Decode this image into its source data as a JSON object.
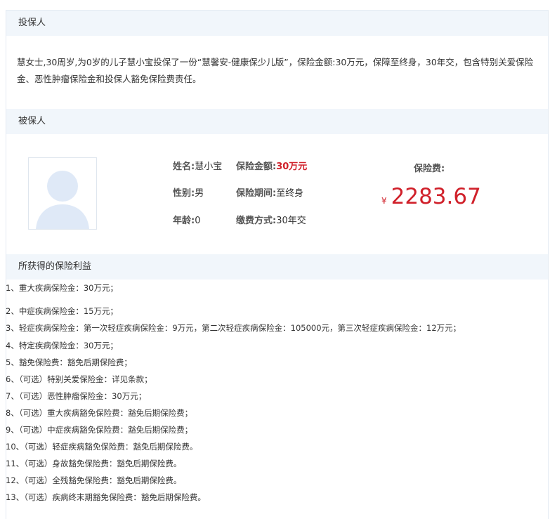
{
  "policyholder": {
    "header": "投保人",
    "summary": "慧女士,30周岁,为0岁的儿子慧小宝投保了一份“慧馨安-健康保少儿版”，保险金额:30万元，保障至终身，30年交，包含特别关爱保险金、恶性肿瘤保险金和投保人豁免保险费责任。"
  },
  "insured": {
    "header": "被保人",
    "name_label": "姓名:",
    "name_value": "慧小宝",
    "gender_label": "性别:",
    "gender_value": "男",
    "age_label": "年龄:",
    "age_value": "0",
    "sum_label": "保险金额:",
    "sum_value": "30万元",
    "period_label": "保险期间:",
    "period_value": "至终身",
    "payment_label": "缴费方式:",
    "payment_value": "30年交",
    "premium_label": "保险费:",
    "currency": "¥",
    "premium_value": "2283.67"
  },
  "benefits": {
    "header": "所获得的保险利益",
    "items": [
      "1、重大疾病保险金：30万元；",
      "2、中症疾病保险金：15万元；",
      "3、轻症疾病保险金：第一次轻症疾病保险金：9万元，第二次轻症疾病保险金：105000元，第三次轻症疾病保险金：12万元；",
      "4、特定疾病保险金：30万元；",
      "5、豁免保险费：豁免后期保险费；",
      "6、（可选）特别关爱保险金：详见条款；",
      "7、（可选）恶性肿瘤保险金：30万元；",
      "8、（可选）重大疾病豁免保险费：豁免后期保险费；",
      "9、（可选）中症疾病豁免保险费：豁免后期保险费；",
      "10、（可选）轻症疾病豁免保险费：豁免后期保险费。",
      "11、（可选）身故豁免保险费：豁免后期保险费。",
      "12、（可选）全残豁免保险费：豁免后期保险费。",
      "13、（可选）疾病终末期豁免保险费：豁免后期保险费。"
    ]
  },
  "colors": {
    "accent_red": "#d0202a",
    "header_bg": "#f1f6fb",
    "avatar_fill": "#dfe9f7"
  },
  "icons": {
    "avatar": "person-silhouette-icon"
  }
}
